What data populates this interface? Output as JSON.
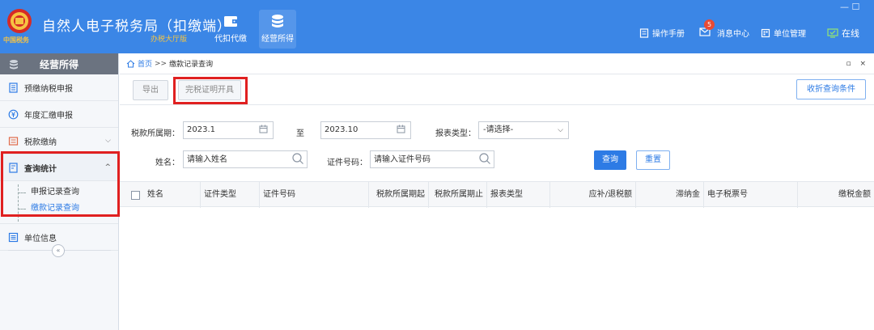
{
  "header": {
    "title": "自然人电子税务局（扣缴端）",
    "subtitle": "办税大厅版",
    "emblem_text": "中国税务",
    "nav": [
      {
        "label": "代扣代缴"
      },
      {
        "label": "经营所得"
      }
    ],
    "tools": {
      "manual": "操作手册",
      "messages": "消息中心",
      "messages_badge": "5",
      "unit_mgmt": "单位管理",
      "online": "在线"
    },
    "window_controls": "— ☐"
  },
  "sidebar": {
    "header": "经营所得",
    "items": [
      {
        "label": "预缴纳税申报"
      },
      {
        "label": "年度汇缴申报"
      },
      {
        "label": "税款缴纳"
      },
      {
        "label": "查询统计",
        "sub": [
          "申报记录查询",
          "缴款记录查询"
        ]
      },
      {
        "label": "单位信息"
      }
    ],
    "collapse": "«"
  },
  "breadcrumb": {
    "home": "首页",
    "sep": ">>",
    "current": "缴款记录查询",
    "controls": "▫ ×"
  },
  "toolbar": {
    "export": "导出",
    "cert": "完税证明开具",
    "fold": "收折查询条件"
  },
  "filters": {
    "period_label": "税款所属期：",
    "period_start": "2023.1",
    "to_label": "至",
    "period_end": "2023.10",
    "report_type_label": "报表类型：",
    "report_type_value": "-请选择-",
    "name_label": "姓名：",
    "name_placeholder": "请输入姓名",
    "id_label": "证件号码：",
    "id_placeholder": "请输入证件号码",
    "query": "查询",
    "reset": "重置"
  },
  "table": {
    "columns": [
      "姓名",
      "证件类型",
      "证件号码",
      "税款所属期起",
      "税款所属期止",
      "报表类型",
      "应补/退税额",
      "滞纳金",
      "电子税票号",
      "缴税金额"
    ]
  },
  "colors": {
    "primary": "#3b86e6",
    "accent": "#2d7be5",
    "highlight": "#e02020"
  }
}
